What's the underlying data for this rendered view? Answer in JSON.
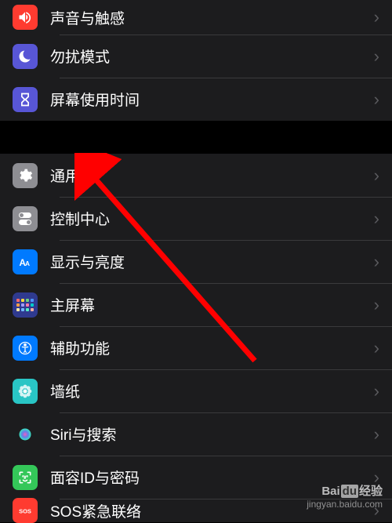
{
  "group1": {
    "items": [
      {
        "label": "声音与触感",
        "icon": "sound"
      },
      {
        "label": "勿扰模式",
        "icon": "dnd"
      },
      {
        "label": "屏幕使用时间",
        "icon": "screentime"
      }
    ]
  },
  "group2": {
    "items": [
      {
        "label": "通用",
        "icon": "general"
      },
      {
        "label": "控制中心",
        "icon": "control"
      },
      {
        "label": "显示与亮度",
        "icon": "display"
      },
      {
        "label": "主屏幕",
        "icon": "home"
      },
      {
        "label": "辅助功能",
        "icon": "accessibility"
      },
      {
        "label": "墙纸",
        "icon": "wallpaper"
      },
      {
        "label": "Siri与搜索",
        "icon": "siri"
      },
      {
        "label": "面容ID与密码",
        "icon": "faceid"
      },
      {
        "label": "SOS紧急联络",
        "icon": "sos"
      }
    ]
  },
  "annotation": {
    "points_to": "通用",
    "color": "#ff0000"
  },
  "watermark": {
    "brand_prefix": "Bai",
    "brand_mid": "du",
    "brand_suffix": "经验",
    "url": "jingyan.baidu.com"
  }
}
